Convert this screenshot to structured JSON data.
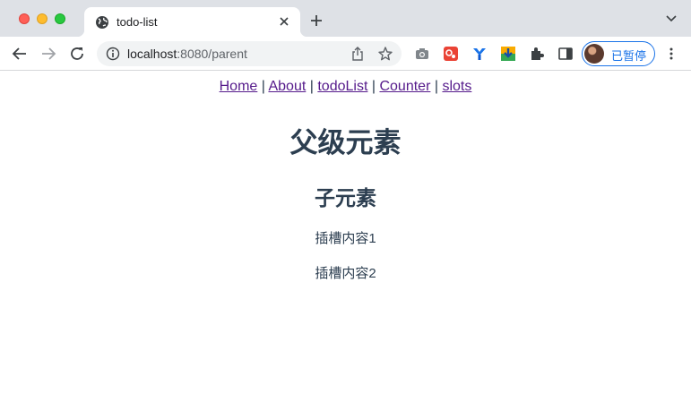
{
  "browser": {
    "tab_title": "todo-list",
    "url_host": "localhost",
    "url_rest": ":8080/parent",
    "profile_label": "已暂停",
    "accent": "#1a73e8"
  },
  "icons": [
    "globe-icon",
    "close-icon",
    "plus-icon",
    "chevron-down-icon",
    "back-arrow-icon",
    "forward-arrow-icon",
    "reload-icon",
    "info-icon",
    "share-icon",
    "star-icon",
    "camera-icon",
    "red-extension-icon",
    "blue-y-extension-icon",
    "download-extension-icon",
    "puzzle-icon",
    "sidepanel-icon",
    "kebab-menu-icon"
  ],
  "nav": {
    "links": [
      "Home",
      "About",
      "todoList",
      "Counter",
      "slots"
    ],
    "separator": "|",
    "link_color": "#551a8b"
  },
  "content": {
    "parent_heading": "父级元素",
    "child_heading": "子元素",
    "slot_1": "插槽内容1",
    "slot_2": "插槽内容2",
    "text_color": "#2c3e50"
  }
}
